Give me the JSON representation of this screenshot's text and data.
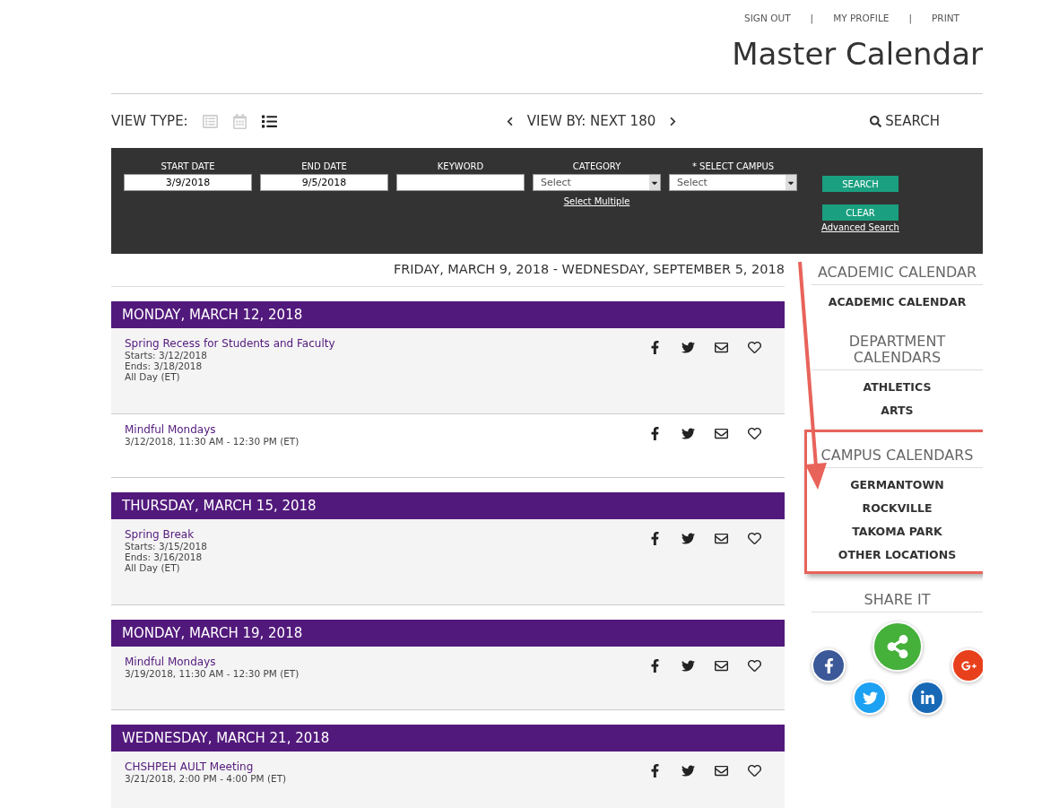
{
  "top_links": [
    "SIGN OUT",
    "MY PROFILE",
    "PRINT"
  ],
  "separators": [
    "|",
    "|"
  ],
  "title": "Master Calendar",
  "view_type": {
    "label": "VIEW TYPE:",
    "options": [
      {
        "kind": "agenda",
        "selected": false
      },
      {
        "kind": "month",
        "selected": false
      },
      {
        "kind": "list",
        "selected": true
      }
    ]
  },
  "view_by": "VIEW BY: NEXT 180",
  "search_link": "SEARCH",
  "search_form": {
    "fields": [
      {
        "kind": "text",
        "label": "START DATE",
        "value": "3/9/2018"
      },
      {
        "kind": "text",
        "label": "END DATE",
        "value": "9/5/2018"
      },
      {
        "kind": "text",
        "label": "KEYWORD"
      },
      {
        "kind": "select",
        "label": "CATEGORY",
        "value": "Select",
        "link": "Select Multiple"
      },
      {
        "kind": "select",
        "label": "* SELECT CAMPUS",
        "value": "Select"
      }
    ],
    "search_button": "SEARCH",
    "clear_button": "CLEAR",
    "advanced_link": "Advanced Search"
  },
  "date_range": "FRIDAY, MARCH 9, 2018 - WEDNESDAY, SEPTEMBER 5, 2018",
  "days": [
    {
      "heading": "MONDAY, MARCH 12, 2018",
      "events": [
        {
          "title": "Spring Recess for Students and Faculty",
          "lines": [
            "Starts: 3/12/2018",
            "Ends: 3/18/2018",
            "All Day (ET)"
          ]
        },
        {
          "title": "Mindful Mondays",
          "lines": [
            "3/12/2018, 11:30 AM - 12:30 PM (ET)"
          ]
        }
      ]
    },
    {
      "heading": "THURSDAY, MARCH 15, 2018",
      "events": [
        {
          "title": "Spring Break",
          "lines": [
            "Starts: 3/15/2018",
            "Ends: 3/16/2018",
            "All Day (ET)"
          ]
        }
      ]
    },
    {
      "heading": "MONDAY, MARCH 19, 2018",
      "events": [
        {
          "title": "Mindful Mondays",
          "lines": [
            "3/19/2018, 11:30 AM - 12:30 PM (ET)"
          ]
        }
      ]
    },
    {
      "heading": "WEDNESDAY, MARCH 21, 2018",
      "events": [
        {
          "title": "CHSHPEH AULT Meeting",
          "lines": [
            "3/21/2018, 2:00 PM - 4:00 PM (ET)"
          ]
        }
      ]
    }
  ],
  "sidebar": [
    {
      "heading": "ACADEMIC CALENDAR",
      "links": [
        "ACADEMIC CALENDAR"
      ],
      "highlighted": false
    },
    {
      "heading": "DEPARTMENT CALENDARS",
      "links": [
        "ATHLETICS",
        "ARTS"
      ],
      "highlighted": false
    },
    {
      "heading": "CAMPUS CALENDARS",
      "links": [
        "GERMANTOWN",
        "ROCKVILLE",
        "TAKOMA PARK",
        "OTHER LOCATIONS"
      ],
      "highlighted": true
    }
  ],
  "share_heading": "SHARE IT"
}
